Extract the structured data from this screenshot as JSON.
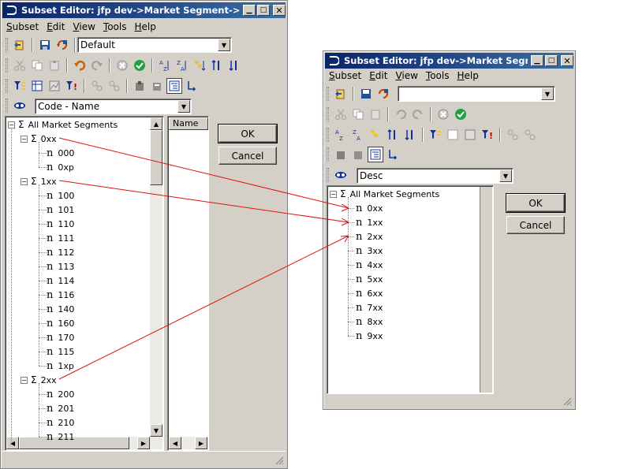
{
  "colors": {
    "title_bar": "#0a246a",
    "arrow": "#e01010",
    "face": "#d4d0c8"
  },
  "editor1": {
    "title": "Subset Editor:  jfp dev->Market Segment->Defa...",
    "menu": [
      "Subset",
      "Edit",
      "View",
      "Tools",
      "Help"
    ],
    "subset_combo": "Default",
    "alias_combo": "Code - Name",
    "tree": {
      "root": "All Market Segments",
      "groups": [
        {
          "label": "0xx",
          "children": [
            "000",
            "0xp"
          ]
        },
        {
          "label": "1xx",
          "children": [
            "100",
            "101",
            "110",
            "111",
            "112",
            "113",
            "114",
            "116",
            "140",
            "160",
            "170",
            "115",
            "1xp"
          ]
        },
        {
          "label": "2xx",
          "children": [
            "200",
            "201",
            "210",
            "211"
          ]
        }
      ]
    },
    "name_column_header": "Name",
    "ok_label": "OK",
    "cancel_label": "Cancel"
  },
  "editor2": {
    "title": "Subset Editor:  jfp dev->Market Segmen...",
    "menu": [
      "Subset",
      "Edit",
      "View",
      "Tools",
      "Help"
    ],
    "subset_combo": "",
    "alias_combo": "Desc",
    "tree": {
      "root": "All Market Segments",
      "children": [
        "0xx",
        "1xx",
        "2xx",
        "3xx",
        "4xx",
        "5xx",
        "6xx",
        "7xx",
        "8xx",
        "9xx"
      ]
    },
    "ok_label": "OK",
    "cancel_label": "Cancel"
  },
  "icons": {
    "title_icon": "tm1-logo-icon",
    "toolbar1": [
      "open-icon",
      "save-icon",
      "save-as-icon",
      "all-subsets-icon",
      "cut-icon",
      "copy-icon",
      "paste-icon",
      "undo-icon",
      "redo-icon",
      "cancel-icon",
      "accept-icon",
      "sort-asc-icon",
      "sort-desc-icon",
      "hierarchy-sort-icon",
      "sort-index-asc-icon",
      "sort-index-desc-icon",
      "filter-level-icon",
      "filter-attribute-icon",
      "filter-data-icon",
      "filter-wildcard-icon",
      "expand-icon",
      "collapse-icon",
      "keep-icon",
      "delete-icon",
      "tree-view-icon",
      "drill-icon",
      "alias-icon"
    ]
  }
}
